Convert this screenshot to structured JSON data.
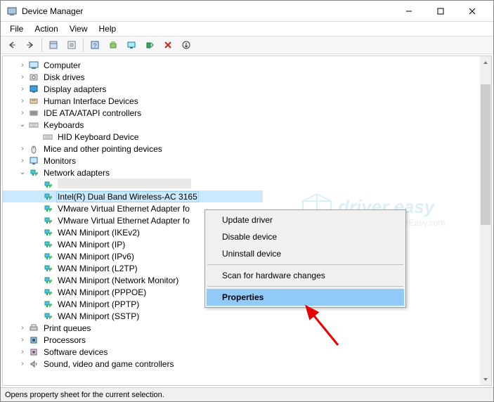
{
  "window": {
    "title": "Device Manager"
  },
  "menubar": [
    "File",
    "Action",
    "View",
    "Help"
  ],
  "toolbar_icons": [
    "back",
    "forward",
    "sep",
    "show-hidden",
    "properties-page",
    "sep",
    "help",
    "update",
    "computer",
    "scan-hardware",
    "uninstall",
    "refresh"
  ],
  "tree": [
    {
      "depth": 1,
      "twisty": ">",
      "icon": "computer",
      "label": "Computer"
    },
    {
      "depth": 1,
      "twisty": ">",
      "icon": "disk",
      "label": "Disk drives"
    },
    {
      "depth": 1,
      "twisty": ">",
      "icon": "display",
      "label": "Display adapters"
    },
    {
      "depth": 1,
      "twisty": ">",
      "icon": "hid",
      "label": "Human Interface Devices"
    },
    {
      "depth": 1,
      "twisty": ">",
      "icon": "ide",
      "label": "IDE ATA/ATAPI controllers"
    },
    {
      "depth": 1,
      "twisty": "v",
      "icon": "keyboard",
      "label": "Keyboards"
    },
    {
      "depth": 2,
      "twisty": "",
      "icon": "keyboard",
      "label": "HID Keyboard Device"
    },
    {
      "depth": 1,
      "twisty": ">",
      "icon": "mouse",
      "label": "Mice and other pointing devices"
    },
    {
      "depth": 1,
      "twisty": ">",
      "icon": "monitor",
      "label": "Monitors"
    },
    {
      "depth": 1,
      "twisty": "v",
      "icon": "network",
      "label": "Network adapters"
    },
    {
      "depth": 2,
      "twisty": "",
      "icon": "network",
      "label": "__OBSCURED__"
    },
    {
      "depth": 2,
      "twisty": "",
      "icon": "network",
      "label": "Intel(R) Dual Band Wireless-AC 3165",
      "selected": true
    },
    {
      "depth": 2,
      "twisty": "",
      "icon": "network",
      "label": "VMware Virtual Ethernet Adapter fo"
    },
    {
      "depth": 2,
      "twisty": "",
      "icon": "network",
      "label": "VMware Virtual Ethernet Adapter fo"
    },
    {
      "depth": 2,
      "twisty": "",
      "icon": "network",
      "label": "WAN Miniport (IKEv2)"
    },
    {
      "depth": 2,
      "twisty": "",
      "icon": "network",
      "label": "WAN Miniport (IP)"
    },
    {
      "depth": 2,
      "twisty": "",
      "icon": "network",
      "label": "WAN Miniport (IPv6)"
    },
    {
      "depth": 2,
      "twisty": "",
      "icon": "network",
      "label": "WAN Miniport (L2TP)"
    },
    {
      "depth": 2,
      "twisty": "",
      "icon": "network",
      "label": "WAN Miniport (Network Monitor)"
    },
    {
      "depth": 2,
      "twisty": "",
      "icon": "network",
      "label": "WAN Miniport (PPPOE)"
    },
    {
      "depth": 2,
      "twisty": "",
      "icon": "network",
      "label": "WAN Miniport (PPTP)"
    },
    {
      "depth": 2,
      "twisty": "",
      "icon": "network",
      "label": "WAN Miniport (SSTP)"
    },
    {
      "depth": 1,
      "twisty": ">",
      "icon": "printer",
      "label": "Print queues"
    },
    {
      "depth": 1,
      "twisty": ">",
      "icon": "cpu",
      "label": "Processors"
    },
    {
      "depth": 1,
      "twisty": ">",
      "icon": "software",
      "label": "Software devices"
    },
    {
      "depth": 1,
      "twisty": ">",
      "icon": "sound",
      "label": "Sound, video and game controllers"
    }
  ],
  "context_menu": {
    "items": [
      {
        "label": "Update driver"
      },
      {
        "label": "Disable device"
      },
      {
        "label": "Uninstall device"
      },
      {
        "sep": true
      },
      {
        "label": "Scan for hardware changes"
      },
      {
        "sep": true
      },
      {
        "label": "Properties",
        "highlight": true
      }
    ]
  },
  "statusbar": {
    "text": "Opens property sheet for the current selection."
  },
  "watermark": {
    "title": "driver easy",
    "url": "www.DriverEasy.com"
  }
}
